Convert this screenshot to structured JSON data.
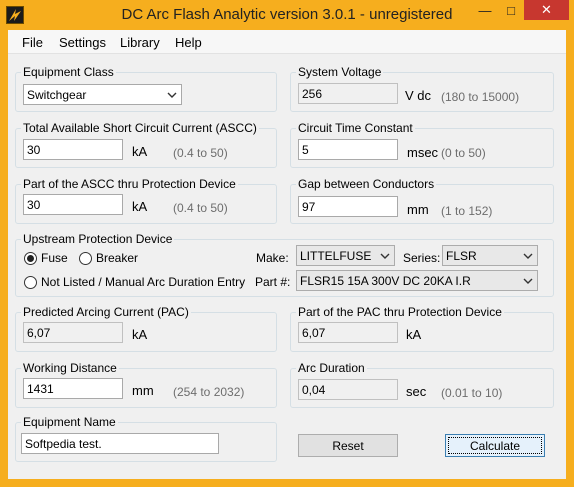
{
  "window": {
    "title": "DC Arc Flash Analytic version 3.0.1 - unregistered",
    "min_glyph": "—",
    "max_glyph": "□",
    "close_glyph": "✕"
  },
  "menu": {
    "file": "File",
    "settings": "Settings",
    "library": "Library",
    "help": "Help"
  },
  "equipment_class": {
    "label": "Equipment Class",
    "selected": "Switchgear"
  },
  "system_voltage": {
    "label": "System Voltage",
    "value": "256",
    "unit": "V dc",
    "range": "(180 to 15000)"
  },
  "ascc": {
    "label": "Total Available Short Circuit Current (ASCC)",
    "value": "30",
    "unit": "kA",
    "range": "(0.4 to 50)"
  },
  "circuit_time_constant": {
    "label": "Circuit Time Constant",
    "value": "5",
    "unit": "msec",
    "range": "(0 to 50)"
  },
  "ascc_thru_device": {
    "label": "Part of the ASCC thru Protection Device",
    "value": "30",
    "unit": "kA",
    "range": "(0.4 to 50)"
  },
  "gap": {
    "label": "Gap between Conductors",
    "value": "97",
    "unit": "mm",
    "range": "(1 to 152)"
  },
  "upstream": {
    "label": "Upstream Protection Device",
    "fuse_label": "Fuse",
    "breaker_label": "Breaker",
    "not_listed_label": "Not Listed / Manual Arc Duration Entry",
    "make_label": "Make:",
    "make_value": "LITTELFUSE",
    "series_label": "Series:",
    "series_value": "FLSR",
    "part_label": "Part #:",
    "part_value": "FLSR15 15A 300V DC 20KA I.R"
  },
  "pac": {
    "label": "Predicted Arcing Current (PAC)",
    "value": "6,07",
    "unit": "kA"
  },
  "pac_thru_device": {
    "label": "Part of the PAC thru Protection Device",
    "value": "6,07",
    "unit": "kA"
  },
  "working_distance": {
    "label": "Working Distance",
    "value": "1431",
    "unit": "mm",
    "range": "(254 to 2032)"
  },
  "arc_duration": {
    "label": "Arc Duration",
    "value": "0,04",
    "unit": "sec",
    "range": "(0.01 to 10)"
  },
  "equipment_name": {
    "label": "Equipment Name",
    "value": "Softpedia test."
  },
  "buttons": {
    "reset": "Reset",
    "calculate": "Calculate"
  },
  "colors": {
    "title_bar": "#f6ae1e",
    "close_button": "#c7372f",
    "client_bg": "#f0f0f0"
  }
}
